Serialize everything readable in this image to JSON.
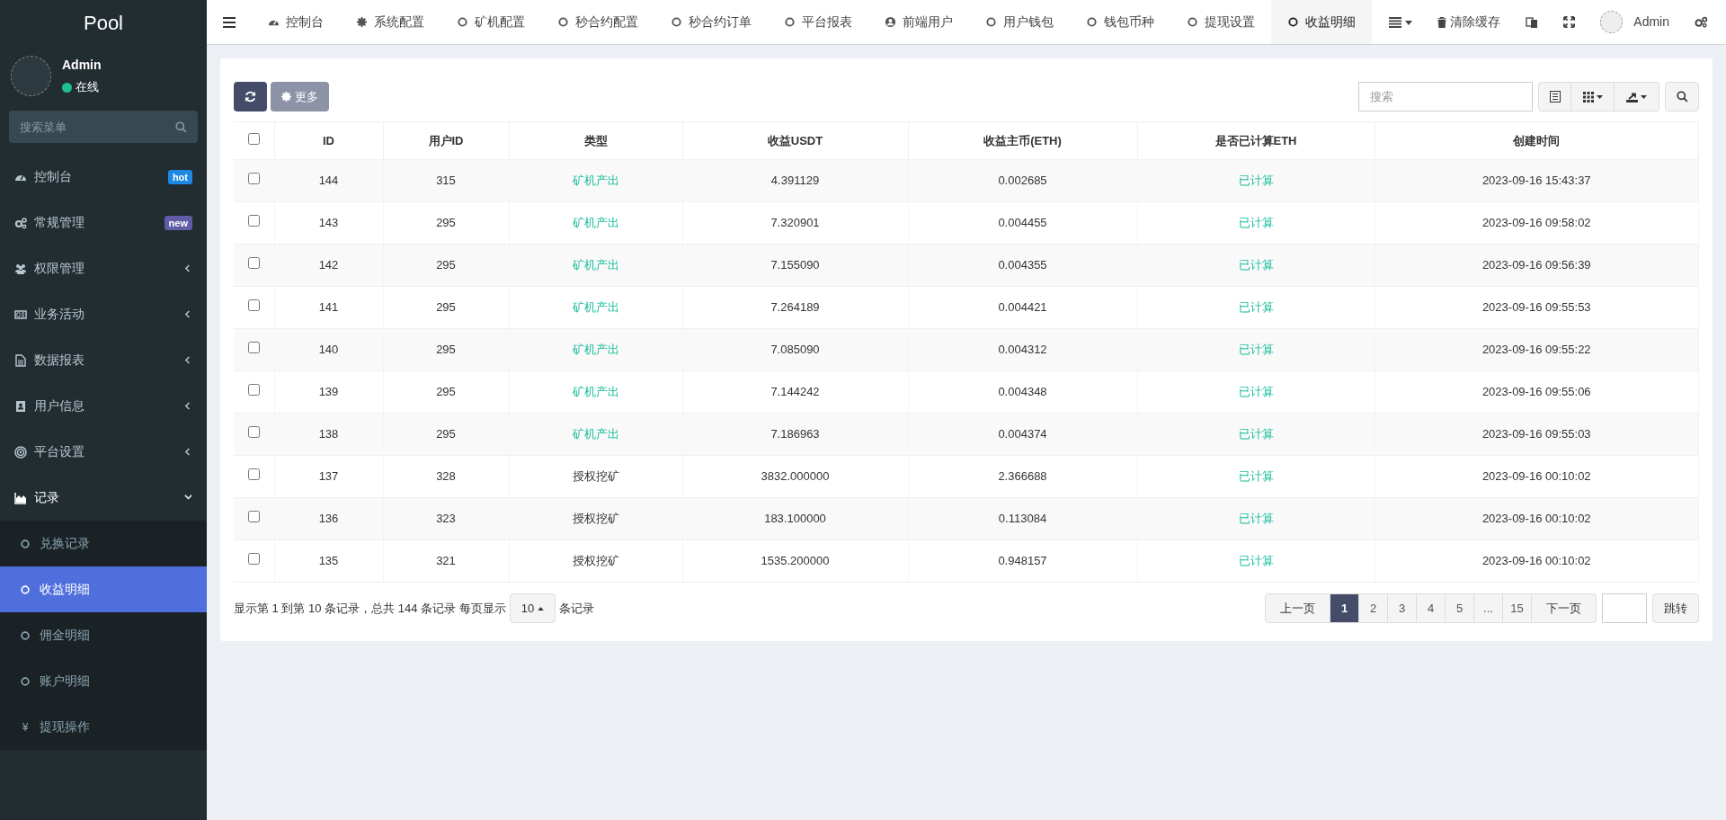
{
  "logo": "Pool",
  "user": {
    "name": "Admin",
    "status": "在线"
  },
  "menu_search": {
    "placeholder": "搜索菜单"
  },
  "sidebar": {
    "items": [
      {
        "label": "控制台",
        "badge": "hot",
        "color": "#1e88e5"
      },
      {
        "label": "常规管理",
        "badge": "new",
        "color": "#605ca8"
      },
      {
        "label": "权限管理",
        "expanded": false
      },
      {
        "label": "业务活动",
        "expanded": false
      },
      {
        "label": "数据报表",
        "expanded": false
      },
      {
        "label": "用户信息",
        "expanded": false
      },
      {
        "label": "平台设置",
        "expanded": false
      },
      {
        "label": "记录",
        "expanded": true,
        "children": [
          {
            "label": "兑换记录",
            "selected": false
          },
          {
            "label": "收益明细",
            "selected": true
          },
          {
            "label": "佣金明细",
            "selected": false
          },
          {
            "label": "账户明细",
            "selected": false
          },
          {
            "label": "提现操作",
            "symbol": "¥",
            "selected": false
          }
        ]
      }
    ]
  },
  "tabs": [
    {
      "label": "控制台",
      "selected": false
    },
    {
      "label": "系统配置",
      "selected": false
    },
    {
      "label": "矿机配置",
      "selected": false
    },
    {
      "label": "秒合约配置",
      "selected": false
    },
    {
      "label": "秒合约订单",
      "selected": false
    },
    {
      "label": "平台报表",
      "selected": false
    },
    {
      "label": "前端用户",
      "selected": false
    },
    {
      "label": "用户钱包",
      "selected": false
    },
    {
      "label": "钱包币种",
      "selected": false
    },
    {
      "label": "提现设置",
      "selected": false
    },
    {
      "label": "收益明细",
      "selected": true
    }
  ],
  "topbar_right": {
    "clear_cache": "清除缓存",
    "admin": "Admin"
  },
  "toolbar": {
    "more": "更多",
    "search_placeholder": "搜索"
  },
  "table": {
    "select_all_checked": false,
    "columns": [
      "ID",
      "用户ID",
      "类型",
      "收益USDT",
      "收益主币(ETH)",
      "是否已计算ETH",
      "创建时间"
    ],
    "rows": [
      {
        "checked": false,
        "id": "144",
        "user_id": "315",
        "type": "矿机产出",
        "color": "#18bc9c",
        "usdt": "4.391129",
        "eth": "0.002685",
        "calc": "已计算",
        "time": "2023-09-16 15:43:37"
      },
      {
        "checked": false,
        "id": "143",
        "user_id": "295",
        "type": "矿机产出",
        "color": "#18bc9c",
        "usdt": "7.320901",
        "eth": "0.004455",
        "calc": "已计算",
        "time": "2023-09-16 09:58:02"
      },
      {
        "checked": false,
        "id": "142",
        "user_id": "295",
        "type": "矿机产出",
        "color": "#18bc9c",
        "usdt": "7.155090",
        "eth": "0.004355",
        "calc": "已计算",
        "time": "2023-09-16 09:56:39"
      },
      {
        "checked": false,
        "id": "141",
        "user_id": "295",
        "type": "矿机产出",
        "color": "#18bc9c",
        "usdt": "7.264189",
        "eth": "0.004421",
        "calc": "已计算",
        "time": "2023-09-16 09:55:53"
      },
      {
        "checked": false,
        "id": "140",
        "user_id": "295",
        "type": "矿机产出",
        "color": "#18bc9c",
        "usdt": "7.085090",
        "eth": "0.004312",
        "calc": "已计算",
        "time": "2023-09-16 09:55:22"
      },
      {
        "checked": false,
        "id": "139",
        "user_id": "295",
        "type": "矿机产出",
        "color": "#18bc9c",
        "usdt": "7.144242",
        "eth": "0.004348",
        "calc": "已计算",
        "time": "2023-09-16 09:55:06"
      },
      {
        "checked": false,
        "id": "138",
        "user_id": "295",
        "type": "矿机产出",
        "color": "#18bc9c",
        "usdt": "7.186963",
        "eth": "0.004374",
        "calc": "已计算",
        "time": "2023-09-16 09:55:03"
      },
      {
        "checked": false,
        "id": "137",
        "user_id": "328",
        "type": "授权挖矿",
        "color": "#333333",
        "usdt": "3832.000000",
        "eth": "2.366688",
        "calc": "已计算",
        "time": "2023-09-16 00:10:02"
      },
      {
        "checked": false,
        "id": "136",
        "user_id": "323",
        "type": "授权挖矿",
        "color": "#333333",
        "usdt": "183.100000",
        "eth": "0.113084",
        "calc": "已计算",
        "time": "2023-09-16 00:10:02"
      },
      {
        "checked": false,
        "id": "135",
        "user_id": "321",
        "type": "授权挖矿",
        "color": "#333333",
        "usdt": "1535.200000",
        "eth": "0.948157",
        "calc": "已计算",
        "time": "2023-09-16 00:10:02"
      }
    ]
  },
  "footer": {
    "summary": "显示第 1 到第 10 条记录，总共 144 条记录 每页显示",
    "page_size": "10",
    "summary_end": "条记录"
  },
  "pagination": {
    "prev": "上一页",
    "next": "下一页",
    "jump": "跳转",
    "pages": [
      {
        "label": "1",
        "selected": true
      },
      {
        "label": "2",
        "selected": false
      },
      {
        "label": "3",
        "selected": false
      },
      {
        "label": "4",
        "selected": false
      },
      {
        "label": "5",
        "selected": false
      },
      {
        "label": "...",
        "selected": false
      },
      {
        "label": "15",
        "selected": false
      }
    ]
  }
}
